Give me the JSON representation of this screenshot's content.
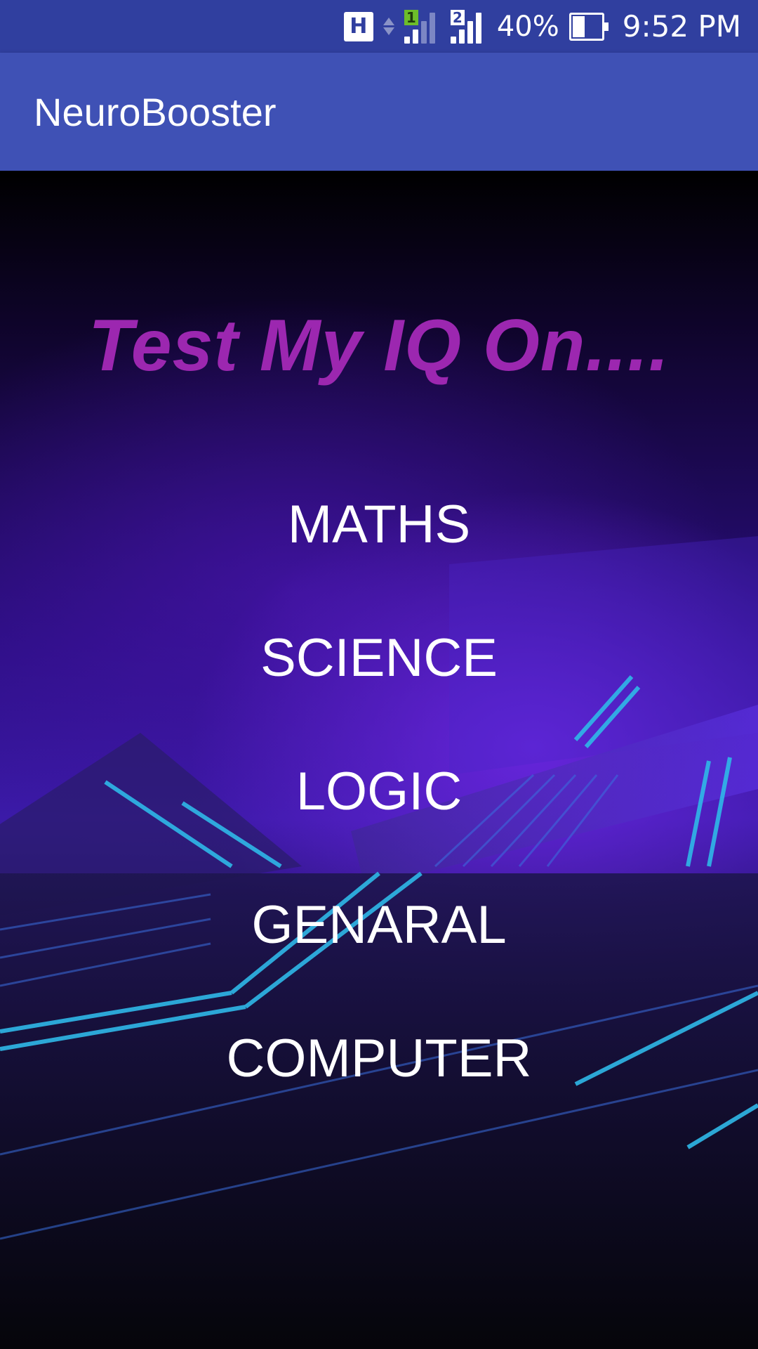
{
  "status_bar": {
    "network_type": "H",
    "sim1_label": "1",
    "sim2_label": "2",
    "battery_percent": "40%",
    "battery_level": 0.4,
    "time": "9:52 PM"
  },
  "app_bar": {
    "title": "NeuroBooster"
  },
  "main": {
    "heading": "Test My IQ On....",
    "options": [
      {
        "label": "MATHS"
      },
      {
        "label": "SCIENCE"
      },
      {
        "label": "LOGIC"
      },
      {
        "label": "GENARAL"
      },
      {
        "label": "COMPUTER"
      }
    ]
  },
  "colors": {
    "status_bar": "#303f9f",
    "app_bar": "#3f51b5",
    "heading": "#9c27b0",
    "option_text": "#ffffff"
  }
}
